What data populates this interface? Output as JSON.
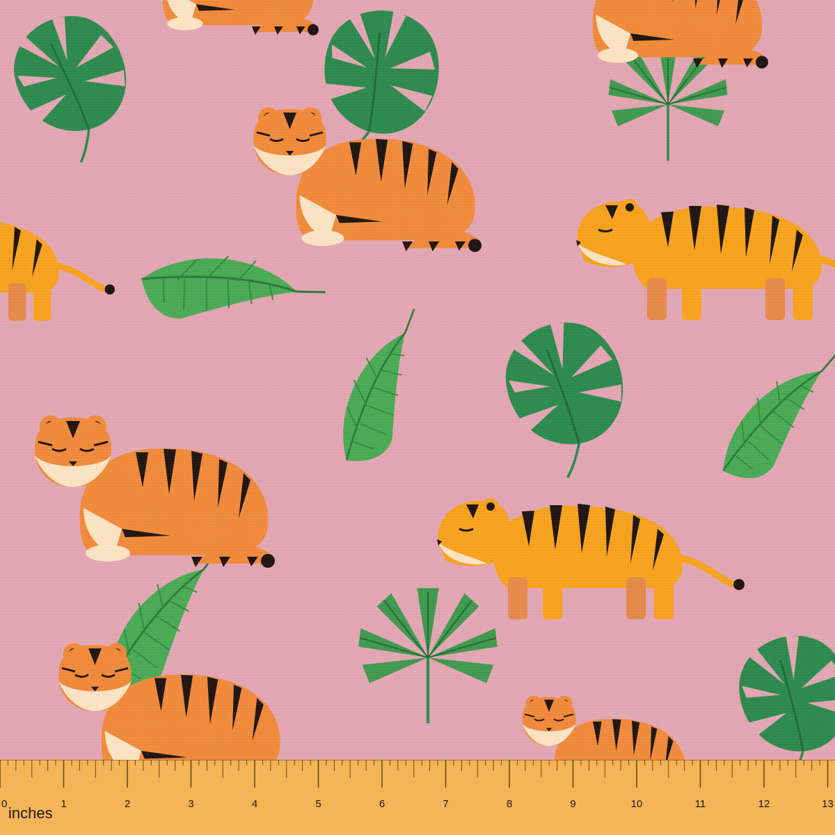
{
  "fabric": {
    "background_color": "#e2a6b3",
    "motifs": [
      "resting-tiger",
      "walking-tiger",
      "monstera-leaf",
      "banana-leaf",
      "palm-leaf"
    ]
  },
  "ruler": {
    "unit_label": "inches",
    "numbers": [
      "0",
      "1",
      "2",
      "3",
      "4",
      "5",
      "6",
      "7",
      "8",
      "9",
      "10",
      "11",
      "12",
      "13"
    ],
    "color": "#f4b457"
  }
}
